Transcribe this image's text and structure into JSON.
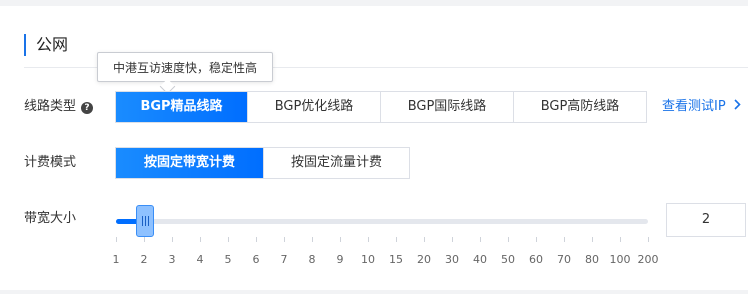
{
  "section": {
    "title": "公网"
  },
  "tooltip": {
    "text": "中港互访速度快，稳定性高"
  },
  "line_type": {
    "label": "线路类型",
    "help_icon": "question-circle-icon",
    "options": [
      "BGP精品线路",
      "BGP优化线路",
      "BGP国际线路",
      "BGP高防线路"
    ],
    "selected": "BGP精品线路",
    "link": "查看测试IP",
    "link_icon": "chevron-right-icon"
  },
  "billing": {
    "label": "计费模式",
    "options": [
      "按固定带宽计费",
      "按固定流量计费"
    ],
    "selected": "按固定带宽计费"
  },
  "bandwidth": {
    "label": "带宽大小",
    "ticks": [
      "1",
      "2",
      "3",
      "4",
      "5",
      "6",
      "7",
      "8",
      "9",
      "10",
      "15",
      "20",
      "30",
      "40",
      "50",
      "60",
      "70",
      "80",
      "100",
      "200"
    ],
    "value": "2"
  },
  "colors": {
    "accent": "#006eff",
    "link": "#1a73e8"
  }
}
